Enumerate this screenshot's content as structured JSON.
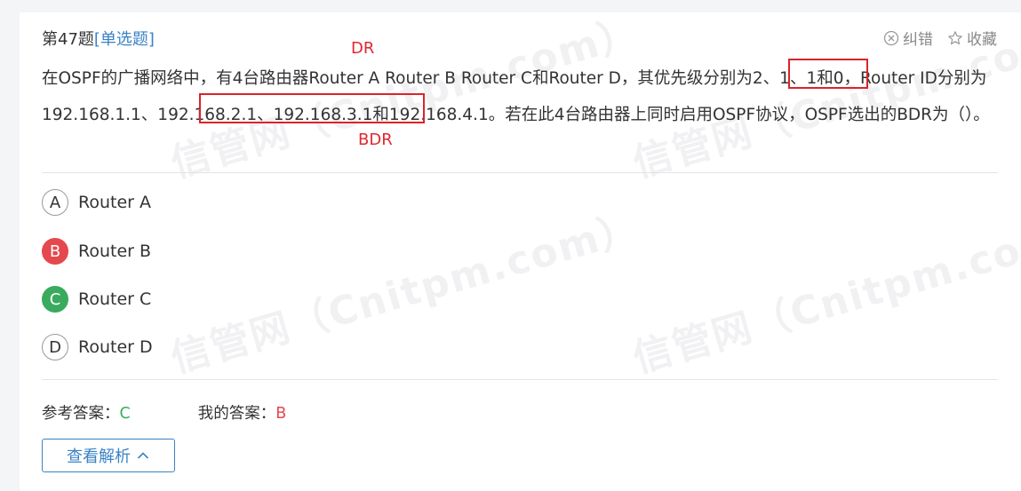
{
  "watermark": "信管网（Cnitpm.com）",
  "question": {
    "number": "第47题",
    "type": "[单选题]",
    "stem": "在OSPF的广播网络中，有4台路由器Router A Router B Router C和Router D，其优先级分别为2、1、1和0，Router ID分别为192.168.1.1、192.168.2.1、192.168.3.1和192.168.4.1。若在此4台路由器上同时启用OSPF协议，OSPF选出的BDR为（）。"
  },
  "actions": {
    "report_label": "纠错",
    "favorite_label": "收藏"
  },
  "annotations": {
    "dr_label": "DR",
    "bdr_label": "BDR"
  },
  "options": [
    {
      "letter": "A",
      "text": "Router A",
      "state": "normal"
    },
    {
      "letter": "B",
      "text": "Router B",
      "state": "wrong"
    },
    {
      "letter": "C",
      "text": "Router C",
      "state": "right"
    },
    {
      "letter": "D",
      "text": "Router D",
      "state": "normal"
    }
  ],
  "answers": {
    "reference_label": "参考答案：",
    "reference_value": "C",
    "mine_label": "我的答案：",
    "mine_value": "B"
  },
  "analysis_button": "查看解析",
  "colors": {
    "accent": "#3b82c4",
    "correct": "#3aaa5e",
    "wrong": "#e5484d",
    "annotation": "#d9242b"
  }
}
